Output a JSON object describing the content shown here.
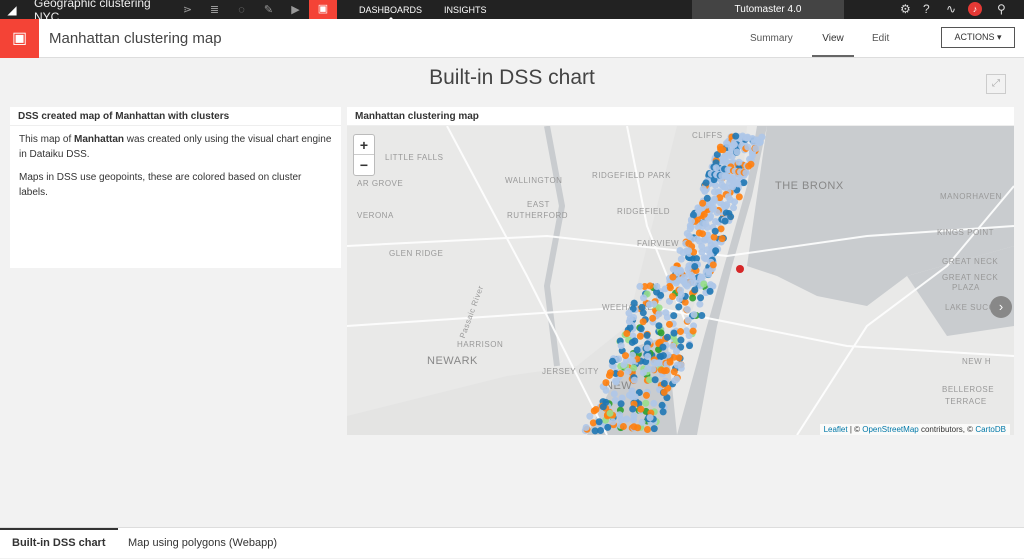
{
  "topbar": {
    "project": "Geographic clustering NYC",
    "nav": [
      {
        "label": "DASHBOARDS",
        "selected": true
      },
      {
        "label": "INSIGHTS",
        "selected": false
      }
    ],
    "instance": "Tutomaster 4.0",
    "icons": [
      "flow-icon",
      "datasets-icon",
      "recipes-icon",
      "notebooks-icon",
      "run-icon",
      "dashboard-icon"
    ],
    "right_icons": [
      "gear-icon",
      "help-icon",
      "activity-icon",
      "bell-icon",
      "search-icon"
    ]
  },
  "header": {
    "title": "Manhattan clustering map",
    "tabs": [
      "Summary",
      "View",
      "Edit"
    ],
    "selected_tab": "View",
    "actions_label": "ACTIONS"
  },
  "page": {
    "title": "Built-in DSS chart"
  },
  "text_panel": {
    "title": "DSS created map of Manhattan with clusters",
    "p1_pre": "This map of ",
    "p1_bold": "Manhattan",
    "p1_post": " was created only using the visual chart engine in Dataiku DSS.",
    "p2": "Maps in DSS use geopoints, these are colored based on cluster labels."
  },
  "map_panel": {
    "title": "Manhattan clustering map",
    "zoom_in": "+",
    "zoom_out": "−",
    "labels": [
      "CLIFFS",
      "LITTLE FALLS",
      "RIDGEFIELD PARK",
      "AR GROVE",
      "WALLINGTON",
      "EAST",
      "RUTHERFORD",
      "RIDGEFIELD",
      "VERONA",
      "THE BRONX",
      "MANORHAVEN",
      "KINGS POINT",
      "GLEN RIDGE",
      "FAIRVIEW",
      "GREAT NECK",
      "GREAT NECK",
      "PLAZA",
      "WEEHAWKEN",
      "LAKE SUCCESS",
      "HARRISON",
      "NEWARK",
      "JERSEY CITY",
      "NEW",
      "NEW H",
      "BELLEROSE",
      "TERRACE",
      "Passaic River",
      "M"
    ],
    "attribution": {
      "leaflet": "Leaflet",
      "sep": " | © ",
      "osm": "OpenStreetMap",
      "mid": " contributors, © ",
      "carto": "CartoDB"
    },
    "cluster_colors": [
      "#1f77b4",
      "#ff7f0e",
      "#aec7e8",
      "#2ca02c",
      "#98df8a",
      "#d62728"
    ]
  },
  "bottom_tabs": [
    {
      "label": "Built-in DSS chart",
      "selected": true
    },
    {
      "label": "Map using polygons (Webapp)",
      "selected": false
    }
  ]
}
